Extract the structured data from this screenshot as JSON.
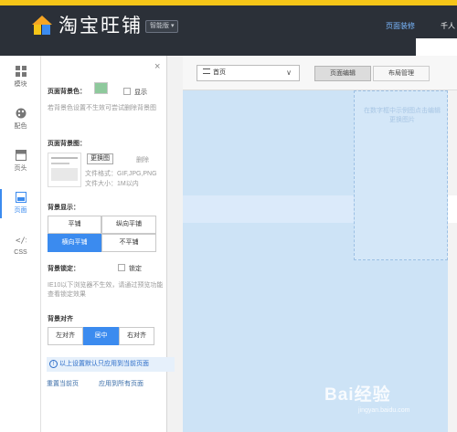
{
  "header": {
    "brand": "淘宝旺铺",
    "edition": "智能版 ▾",
    "link_active": "页面装修",
    "link_other": "千人"
  },
  "leftnav": {
    "items": [
      {
        "label": "模块",
        "icon": "modules-icon"
      },
      {
        "label": "配色",
        "icon": "palette-icon"
      },
      {
        "label": "页头",
        "icon": "page-header-icon"
      },
      {
        "label": "页面",
        "icon": "page-icon",
        "active": true
      },
      {
        "label": "CSS",
        "icon": "css-icon"
      }
    ]
  },
  "panel": {
    "close": "×",
    "bg_color_label": "页面背景色：",
    "bg_color_value": "#8ec99c",
    "show_label": "显示",
    "bg_color_note": "若背景色设置不生效可尝试删除背景图",
    "bg_image_label": "页面背景图：",
    "change_image_btn": "更换图",
    "delete_link": "删除",
    "file_format": "文件格式：GIF,JPG,PNG",
    "file_size": "文件大小：1M以内",
    "bg_display_label": "背景显示：",
    "bg_display_options": [
      "平铺",
      "纵向平铺",
      "横向平铺",
      "不平铺"
    ],
    "bg_display_selected": "横向平铺",
    "bg_lock_label": "背景锁定：",
    "lock_label": "锁定",
    "ie_note": "IE10以下浏览器不生效，请通过预览功能查看锁定效果",
    "bg_align_label": "背景对齐",
    "bg_align_options": [
      "左对齐",
      "居中",
      "右对齐"
    ],
    "bg_align_selected": "居中",
    "tip": "以上设置默认只应用到当前页面",
    "reset_link": "重置当前页",
    "apply_all_link": "应用到所有页面"
  },
  "toolbar": {
    "page_select": "首页",
    "tab_edit": "页面编辑",
    "tab_layout": "布局管理"
  },
  "canvas": {
    "placeholder": "在数字框中示例图点击编辑更换图片"
  },
  "watermark": {
    "text": "Bai经验",
    "sub": "jingyan.baidu.com"
  }
}
